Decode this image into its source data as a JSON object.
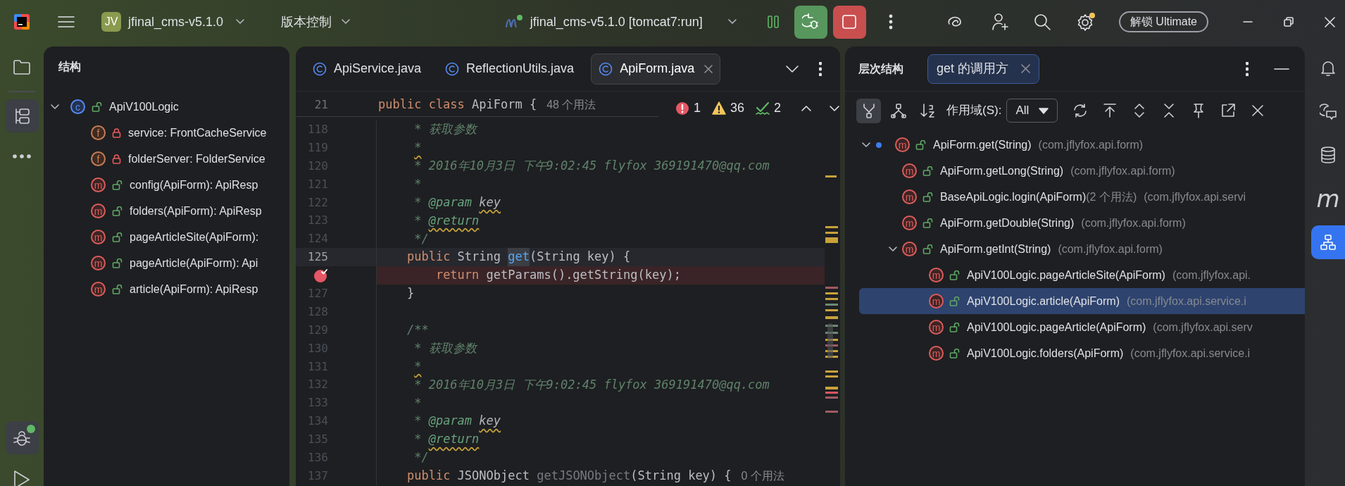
{
  "title_bar": {
    "project": {
      "badge": "JV",
      "name": "jfinal_cms-v5.1.0"
    },
    "vcs": "版本控制",
    "run_config": "jfinal_cms-v5.1.0 [tomcat7:run]",
    "unlock_button": "解锁 Ultimate",
    "settings_notice": true
  },
  "left_toolbar": {
    "top": [
      {
        "kind": "project",
        "selected": false
      },
      {
        "kind": "structure",
        "selected": true
      },
      {
        "kind": "more",
        "selected": false
      }
    ],
    "bottom": [
      {
        "kind": "debug",
        "selected": true
      },
      {
        "kind": "run",
        "selected": false
      }
    ]
  },
  "structure_panel": {
    "title": "结构",
    "tree": [
      {
        "kind": "class",
        "badge": "c",
        "private": false,
        "label": "ApiV100Logic",
        "expanded": true,
        "children": [
          {
            "kind": "field",
            "badge": "f",
            "private": true,
            "label": "service: FrontCacheService"
          },
          {
            "kind": "field",
            "badge": "f",
            "private": true,
            "label": "folderServer: FolderService"
          },
          {
            "kind": "method",
            "badge": "m",
            "private": false,
            "label": "config(ApiForm): ApiResp"
          },
          {
            "kind": "method",
            "badge": "m",
            "private": false,
            "label": "folders(ApiForm): ApiResp"
          },
          {
            "kind": "method",
            "badge": "m",
            "private": false,
            "label": "pageArticleSite(ApiForm):"
          },
          {
            "kind": "method",
            "badge": "m",
            "private": false,
            "label": "pageArticle(ApiForm): Api"
          },
          {
            "kind": "method",
            "badge": "m",
            "private": false,
            "label": "article(ApiForm): ApiResp"
          }
        ]
      }
    ]
  },
  "editor": {
    "tabs": [
      {
        "label": "ApiService.java",
        "selected": false
      },
      {
        "label": "ReflectionUtils.java",
        "selected": false
      },
      {
        "label": "ApiForm.java",
        "selected": true
      }
    ],
    "sticky_line": {
      "number": "21",
      "segments": [
        {
          "kind": "kw",
          "text": "public class "
        },
        {
          "kind": "plain",
          "text": "ApiForm {"
        },
        {
          "kind": "hint",
          "text": "48 个用法"
        }
      ]
    },
    "inspections": {
      "errors": "1",
      "warnings": "36",
      "typos": "2"
    },
    "lines": [
      {
        "number": "118",
        "current": false,
        "breakpoint": false,
        "segments": [
          {
            "kind": "comment",
            "text": "     * 获取参数"
          }
        ]
      },
      {
        "number": "119",
        "current": false,
        "breakpoint": false,
        "segments": [
          {
            "kind": "comment",
            "text": "     *",
            "typo": true
          }
        ]
      },
      {
        "number": "120",
        "current": false,
        "breakpoint": false,
        "segments": [
          {
            "kind": "comment",
            "text": "     * 2016年10月3日 下午9:02:45 flyfox 369191470@qq.com"
          }
        ]
      },
      {
        "number": "121",
        "current": false,
        "breakpoint": false,
        "segments": [
          {
            "kind": "comment",
            "text": "     *"
          }
        ]
      },
      {
        "number": "122",
        "current": false,
        "breakpoint": false,
        "segments": [
          {
            "kind": "comment",
            "text": "     * "
          },
          {
            "kind": "doctag",
            "text": "@param "
          },
          {
            "kind": "param",
            "text": "key",
            "typo": true
          }
        ]
      },
      {
        "number": "123",
        "current": false,
        "breakpoint": false,
        "segments": [
          {
            "kind": "comment",
            "text": "     * "
          },
          {
            "kind": "doctag",
            "text": "@return",
            "typo": true
          }
        ]
      },
      {
        "number": "124",
        "current": false,
        "breakpoint": false,
        "segments": [
          {
            "kind": "comment",
            "text": "     */"
          }
        ]
      },
      {
        "number": "125",
        "current": true,
        "breakpoint": false,
        "segments": [
          {
            "kind": "kw",
            "text": "    public "
          },
          {
            "kind": "plain",
            "text": "String "
          },
          {
            "kind": "hl",
            "text": "get"
          },
          {
            "kind": "plain",
            "text": "(String key) {"
          }
        ]
      },
      {
        "current": false,
        "breakpoint": true,
        "segments": [
          {
            "kind": "kw",
            "text": "        return "
          },
          {
            "kind": "plain",
            "text": "getParams().getString(key);"
          }
        ]
      },
      {
        "number": "127",
        "current": false,
        "breakpoint": false,
        "segments": [
          {
            "kind": "plain",
            "text": "    }"
          }
        ]
      },
      {
        "number": "128",
        "current": false,
        "breakpoint": false
      },
      {
        "number": "129",
        "current": false,
        "breakpoint": false,
        "segments": [
          {
            "kind": "comment",
            "text": "    /**"
          }
        ]
      },
      {
        "number": "130",
        "current": false,
        "breakpoint": false,
        "segments": [
          {
            "kind": "comment",
            "text": "     * 获取参数"
          }
        ]
      },
      {
        "number": "131",
        "current": false,
        "breakpoint": false,
        "segments": [
          {
            "kind": "comment",
            "text": "     *",
            "typo": true
          }
        ]
      },
      {
        "number": "132",
        "current": false,
        "breakpoint": false,
        "segments": [
          {
            "kind": "comment",
            "text": "     * 2016年10月3日 下午9:02:45 flyfox 369191470@qq.com"
          }
        ]
      },
      {
        "number": "133",
        "current": false,
        "breakpoint": false,
        "segments": [
          {
            "kind": "comment",
            "text": "     *"
          }
        ]
      },
      {
        "number": "134",
        "current": false,
        "breakpoint": false,
        "segments": [
          {
            "kind": "comment",
            "text": "     * "
          },
          {
            "kind": "doctag",
            "text": "@param "
          },
          {
            "kind": "param",
            "text": "key",
            "typo": true
          }
        ]
      },
      {
        "number": "135",
        "current": false,
        "breakpoint": false,
        "segments": [
          {
            "kind": "comment",
            "text": "     * "
          },
          {
            "kind": "doctag",
            "text": "@return",
            "typo": true
          }
        ]
      },
      {
        "number": "136",
        "current": false,
        "breakpoint": false,
        "segments": [
          {
            "kind": "comment",
            "text": "     */"
          }
        ]
      },
      {
        "number": "137",
        "current": false,
        "breakpoint": false,
        "segments": [
          {
            "kind": "kw",
            "text": "    public "
          },
          {
            "kind": "plain",
            "text": "JSONObject "
          },
          {
            "kind": "unused",
            "text": "getJSONObject"
          },
          {
            "kind": "plain",
            "text": "(String key) {"
          },
          {
            "kind": "hint",
            "text": "0 个用法"
          }
        ]
      }
    ]
  },
  "hierarchy_panel": {
    "title": "层次结构",
    "tab": {
      "label": "get 的调用方",
      "selected": true
    },
    "view_buttons": [
      {
        "kind": "callers",
        "selected": true
      },
      {
        "kind": "callees",
        "selected": false
      },
      {
        "kind": "sort",
        "selected": false
      }
    ],
    "scope_label": "作用域(S):",
    "scope_value": "All",
    "actions": [
      {
        "kind": "refresh"
      },
      {
        "kind": "export"
      },
      {
        "kind": "expand"
      },
      {
        "kind": "collapse"
      },
      {
        "kind": "pin"
      },
      {
        "kind": "open"
      },
      {
        "kind": "close"
      }
    ],
    "tree": [
      {
        "badge": "m",
        "private": false,
        "name": "ApiForm.get(String)",
        "package": "(com.jflyfox.api.form)",
        "current": true,
        "selected": false,
        "expanded": true,
        "children": [
          {
            "badge": "m",
            "private": false,
            "name": "ApiForm.getLong(String)",
            "package": "(com.jflyfox.api.form)",
            "current": false,
            "selected": false
          },
          {
            "badge": "m",
            "private": false,
            "name": "BaseApiLogic.login(ApiForm)",
            "usages": "(2 个用法)",
            "package": "(com.jflyfox.api.servi",
            "current": false,
            "selected": false
          },
          {
            "badge": "m",
            "private": false,
            "name": "ApiForm.getDouble(String)",
            "package": "(com.jflyfox.api.form)",
            "current": false,
            "selected": false
          },
          {
            "badge": "m",
            "private": false,
            "name": "ApiForm.getInt(String)",
            "package": "(com.jflyfox.api.form)",
            "current": false,
            "selected": false,
            "expanded": true,
            "children": [
              {
                "badge": "m",
                "private": false,
                "name": "ApiV100Logic.pageArticleSite(ApiForm)",
                "package": "(com.jflyfox.api.",
                "current": false,
                "selected": false
              },
              {
                "badge": "m",
                "private": false,
                "name": "ApiV100Logic.article(ApiForm)",
                "package": "(com.jflyfox.api.service.i",
                "current": false,
                "selected": true
              },
              {
                "badge": "m",
                "private": false,
                "name": "ApiV100Logic.pageArticle(ApiForm)",
                "package": "(com.jflyfox.api.serv",
                "current": false,
                "selected": false
              },
              {
                "badge": "m",
                "private": false,
                "name": "ApiV100Logic.folders(ApiForm)",
                "package": "(com.jflyfox.api.service.i",
                "current": false,
                "selected": false
              }
            ]
          }
        ]
      }
    ]
  },
  "right_toolbar": [
    {
      "kind": "notifications",
      "selected": false
    },
    {
      "kind": "ai-chat",
      "selected": false
    },
    {
      "kind": "database",
      "selected": false
    },
    {
      "kind": "plugin",
      "glyph": "m",
      "selected": false
    },
    {
      "kind": "hierarchy",
      "selected": true
    }
  ]
}
